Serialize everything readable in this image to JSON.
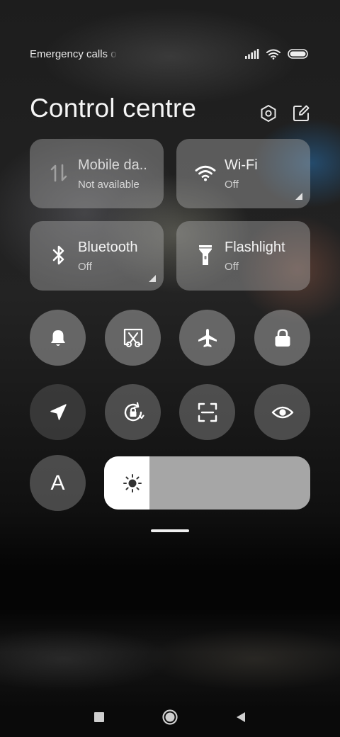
{
  "status_bar": {
    "carrier_text": "Emergency calls o",
    "icons": [
      "signal-icon",
      "wifi-icon",
      "battery-icon"
    ]
  },
  "header": {
    "title": "Control centre",
    "actions": [
      "settings-icon",
      "edit-icon"
    ]
  },
  "tiles": [
    {
      "id": "mobile-data",
      "title": "Mobile da..",
      "subtitle": "Not available",
      "icon": "mobile-data-icon",
      "state": "unavailable"
    },
    {
      "id": "wifi",
      "title": "Wi-Fi",
      "subtitle": "Off",
      "icon": "wifi-icon",
      "state": "off",
      "expandable": true
    },
    {
      "id": "bluetooth",
      "title": "Bluetooth",
      "subtitle": "Off",
      "icon": "bluetooth-icon",
      "state": "off",
      "expandable": true
    },
    {
      "id": "flashlight",
      "title": "Flashlight",
      "subtitle": "Off",
      "icon": "flashlight-icon",
      "state": "off"
    }
  ],
  "toggles": [
    {
      "id": "ringer",
      "icon": "bell-icon"
    },
    {
      "id": "screenshot",
      "icon": "scissors-icon"
    },
    {
      "id": "airplane",
      "icon": "airplane-icon"
    },
    {
      "id": "lock-screen",
      "icon": "lock-icon"
    },
    {
      "id": "location",
      "icon": "location-arrow-icon"
    },
    {
      "id": "rotation-lock",
      "icon": "rotation-lock-icon"
    },
    {
      "id": "scanner",
      "icon": "scanner-icon"
    },
    {
      "id": "reading-mode",
      "icon": "eye-icon"
    },
    {
      "id": "auto-brightness",
      "label": "A",
      "icon": "auto-brightness-icon"
    }
  ],
  "brightness": {
    "level_fraction": 0.22,
    "icon": "sun-icon"
  },
  "nav_bar": [
    "recents-icon",
    "home-icon",
    "back-icon"
  ],
  "colors": {
    "tile_bg": "#a8a8a8",
    "slider_fill": "#ffffff",
    "slider_track": "#a6a6a6"
  }
}
